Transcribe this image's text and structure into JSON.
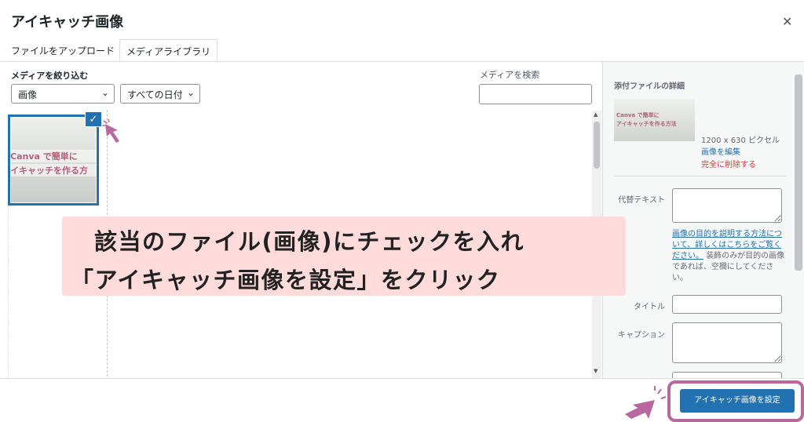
{
  "dialog": {
    "title": "アイキャッチ画像",
    "close_icon": "close-icon"
  },
  "tabs": [
    {
      "label": "ファイルをアップロード",
      "active": false
    },
    {
      "label": "メディアライブラリ",
      "active": true
    }
  ],
  "filters": {
    "label": "メディアを絞り込む",
    "type_selected": "画像",
    "date_selected": "すべての日付"
  },
  "search": {
    "label": "メディアを検索",
    "value": ""
  },
  "grid": {
    "item": {
      "thumb_line1": "Canva で簡単に",
      "thumb_line2": "イキャッチを作る方",
      "selected": true
    }
  },
  "details": {
    "title": "添付ファイルの詳細",
    "thumb_line1": "Canva で簡単に",
    "thumb_line2": "アイキャッチを作る方法",
    "size": "1200 x 630 ピクセル",
    "edit_link": "画像を編集",
    "delete_link": "完全に削除する",
    "alt_label": "代替テキスト",
    "alt_help_link": "画像の目的を説明する方法について、詳しくはこちらをご覧ください。",
    "alt_help_text": "装飾のみが目的の画像であれば、空欄にしてください。",
    "title_label": "タイトル",
    "caption_label": "キャプション"
  },
  "footer": {
    "set_button": "アイキャッチ画像を設定"
  },
  "annotation": {
    "line1": "該当のファイル(画像)にチェックを入れ",
    "line2": "「アイキャッチ画像を設定」をクリック",
    "highlight_color": "#b7689c",
    "pointer_color": "#b7689c"
  },
  "colors": {
    "accent": "#2271b1",
    "danger": "#d63638",
    "overlay_bg": "#ffd8d8"
  }
}
